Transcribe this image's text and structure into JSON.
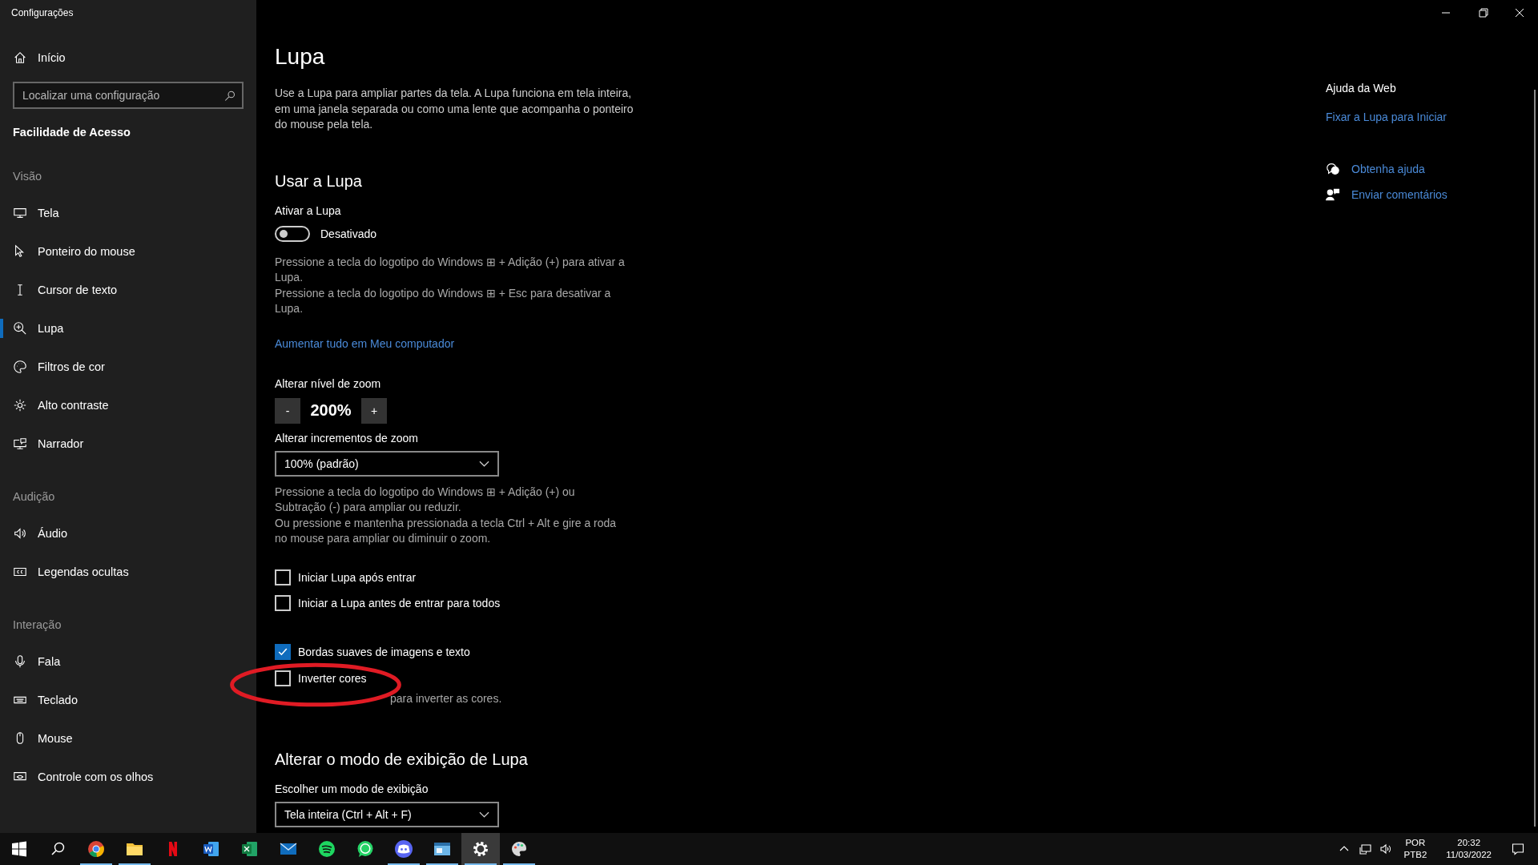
{
  "window": {
    "title": "Configurações"
  },
  "sidebar": {
    "home": "Início",
    "search": {
      "placeholder": "Localizar uma configuração"
    },
    "heading": "Facilidade de Acesso",
    "groups": [
      {
        "label": "Visão",
        "items": [
          {
            "label": "Tela",
            "selected": false
          },
          {
            "label": "Ponteiro do mouse",
            "selected": false
          },
          {
            "label": "Cursor de texto",
            "selected": false
          },
          {
            "label": "Lupa",
            "selected": true
          },
          {
            "label": "Filtros de cor",
            "selected": false
          },
          {
            "label": "Alto contraste",
            "selected": false
          },
          {
            "label": "Narrador",
            "selected": false
          }
        ]
      },
      {
        "label": "Audição",
        "items": [
          {
            "label": "Áudio",
            "selected": false
          },
          {
            "label": "Legendas ocultas",
            "selected": false
          }
        ]
      },
      {
        "label": "Interação",
        "items": [
          {
            "label": "Fala",
            "selected": false
          },
          {
            "label": "Teclado",
            "selected": false
          },
          {
            "label": "Mouse",
            "selected": false
          },
          {
            "label": "Controle com os olhos",
            "selected": false
          }
        ]
      }
    ]
  },
  "main": {
    "title": "Lupa",
    "intro": "Use a Lupa para ampliar partes da tela. A Lupa funciona em tela inteira, em uma janela separada ou como uma lente que acompanha o ponteiro do mouse pela tela.",
    "use_heading": "Usar a Lupa",
    "toggle": {
      "label": "Ativar a Lupa",
      "on": false,
      "state_text": "Desativado"
    },
    "toggle_hints": [
      "Pressione a tecla do logotipo do Windows ⊞ + Adição (+) para ativar a Lupa.",
      "Pressione a tecla do logotipo do Windows ⊞ + Esc para desativar a Lupa."
    ],
    "link": "Aumentar tudo em Meu computador",
    "zoom": {
      "label": "Alterar nível de zoom",
      "minus": "-",
      "value": "200%",
      "plus": "+"
    },
    "increments": {
      "label": "Alterar incrementos de zoom",
      "value": "100% (padrão)"
    },
    "zoom_hints": [
      "Pressione a tecla do logotipo do Windows ⊞ + Adição (+) ou Subtração (-) para ampliar ou reduzir.",
      "Ou pressione e mantenha pressionada a tecla Ctrl + Alt e gire a roda no mouse para ampliar ou diminuir o zoom."
    ],
    "startup_options": [
      {
        "label": "Iniciar Lupa após entrar",
        "checked": false
      },
      {
        "label": "Iniciar a Lupa antes de entrar para todos",
        "checked": false
      }
    ],
    "appearance_options": [
      {
        "label": "Bordas suaves de imagens e texto",
        "checked": true
      },
      {
        "label": "Inverter cores",
        "checked": false
      }
    ],
    "invert_hint": "para inverter as cores.",
    "view_heading": "Alterar o modo de exibição de Lupa",
    "view_mode": {
      "label": "Escolher um modo de exibição",
      "value": "Tela inteira (Ctrl + Alt + F)"
    }
  },
  "help": {
    "heading": "Ajuda da Web",
    "link": "Fixar a Lupa para Iniciar",
    "actions": [
      "Obtenha ajuda",
      "Enviar comentários"
    ]
  },
  "taskbar": {
    "apps": [
      {
        "running": true,
        "selected": false
      },
      {
        "running": true,
        "selected": false
      },
      {
        "running": false,
        "selected": false
      },
      {
        "running": false,
        "selected": false
      },
      {
        "running": false,
        "selected": false
      },
      {
        "running": false,
        "selected": false
      },
      {
        "running": false,
        "selected": false
      },
      {
        "running": false,
        "selected": false
      },
      {
        "running": true,
        "selected": false
      },
      {
        "running": true,
        "selected": false
      },
      {
        "running": true,
        "selected": true
      },
      {
        "running": true,
        "selected": false
      }
    ],
    "tray": {
      "language": "POR",
      "layout": "PTB2",
      "time": "20:32",
      "date": "11/03/2022"
    }
  }
}
